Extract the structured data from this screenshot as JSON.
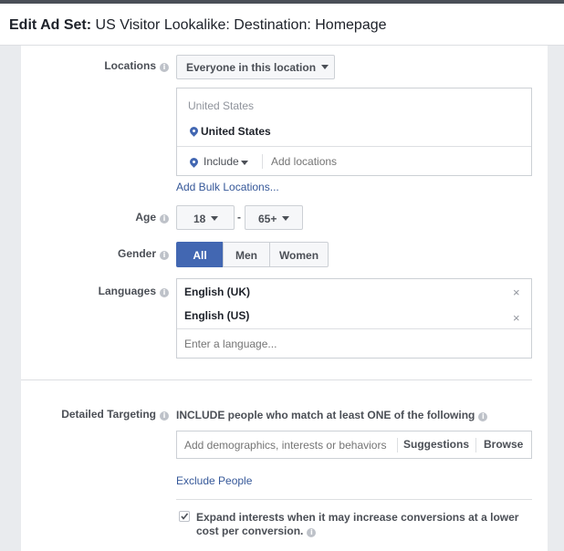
{
  "header": {
    "title_bold": "Edit Ad Set:",
    "title_rest": "US Visitor Lookalike: Destination: Homepage"
  },
  "locations": {
    "label": "Locations",
    "scope_dropdown": "Everyone in this location",
    "list_heading": "United States",
    "selected": "United States",
    "include_dropdown": "Include",
    "add_placeholder": "Add locations",
    "bulk_link": "Add Bulk Locations..."
  },
  "age": {
    "label": "Age",
    "min": "18",
    "separator": "-",
    "max": "65+"
  },
  "gender": {
    "label": "Gender",
    "options": [
      "All",
      "Men",
      "Women"
    ],
    "selected": "All"
  },
  "languages": {
    "label": "Languages",
    "selected": [
      "English (UK)",
      "English (US)"
    ],
    "remove_glyph": "×",
    "placeholder": "Enter a language..."
  },
  "detailed_targeting": {
    "label": "Detailed Targeting",
    "description": "INCLUDE people who match at least ONE of the following",
    "input_placeholder": "Add demographics, interests or behaviors",
    "suggestions_label": "Suggestions",
    "browse_label": "Browse",
    "exclude_link": "Exclude People",
    "expand_line1": "Expand interests when it may increase conversions at a lower",
    "expand_line2": "cost per conversion.",
    "expand_checked": true
  },
  "colors": {
    "accent": "#4267b2",
    "link": "#365899",
    "border": "#ccd0d5",
    "muted": "#90949c"
  }
}
